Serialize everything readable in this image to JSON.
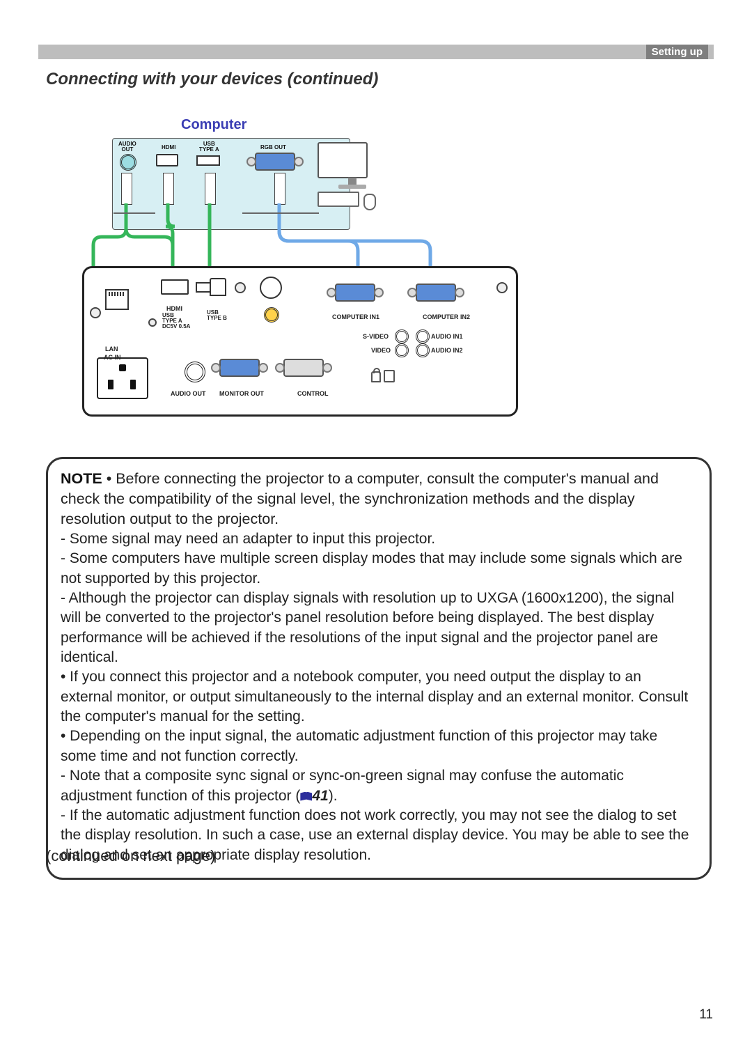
{
  "header": {
    "chapter": "Setting up"
  },
  "title": "Connecting with your devices (continued)",
  "figure": {
    "computer_label": "Computer",
    "computer_ports": {
      "audio_out": "AUDIO\nOUT",
      "hdmi": "HDMI",
      "usb_a": "USB\nTYPE A",
      "rgb_out": "RGB OUT"
    },
    "projector_ports": {
      "hdmi": "HDMI",
      "usb_a": "USB\nTYPE A\nDC5V 0.5A",
      "usb_b": "USB\nTYPE B",
      "lan": "LAN",
      "ac_in": "AC IN",
      "computer_in1": "COMPUTER IN1",
      "computer_in2": "COMPUTER IN2",
      "svideo": "S-VIDEO",
      "video": "VIDEO",
      "audio_in1": "AUDIO IN1",
      "audio_in2": "AUDIO IN2",
      "audio_out": "AUDIO OUT",
      "monitor_out": "MONITOR OUT",
      "control": "CONTROL",
      "usb_icon": "⇔"
    },
    "colors": {
      "audio_cable": "#35b65a",
      "computer_cable": "#35b65a",
      "hdmi_cable": "#35b65a",
      "usb_cable": "#35b65a",
      "rgb_cable": "#6fa9e7",
      "panel_tint": "#d7eff3",
      "accent": "#3a3db3"
    }
  },
  "note": {
    "label": "NOTE",
    "p1": " • Before connecting the projector to a computer, consult the computer's manual and check the compatibility of the signal level, the synchronization methods and the display resolution output to the projector.",
    "b1": "- Some signal may need an adapter to input this projector.",
    "b2": "- Some computers have multiple screen display modes that may include some signals which are not supported by this projector.",
    "b3": "- Although the projector can display signals with resolution up to UXGA (1600x1200), the signal will be converted to the projector's panel resolution before being displayed. The best display performance will be achieved if the resolutions of the input signal and the projector panel are identical.",
    "p2": "• If you connect this projector and a notebook computer, you need output the display to an external monitor, or output simultaneously to the internal display and an external monitor. Consult the computer's manual for the setting.",
    "p3": "• Depending on the input signal, the automatic adjustment function of this projector may take some time and not function correctly.",
    "b4a": "- Note that a composite sync signal or sync-on-green signal may confuse the automatic adjustment function of this projector (",
    "b4_ref": "41",
    "b4b": ").",
    "b5": "- If the automatic adjustment function does not work correctly, you may not see the dialog to set the display resolution. In such a case, use an external display device. You may be able to see the dialog and set an appropriate display resolution."
  },
  "continued": "(continued on next page)",
  "page_number": "11"
}
